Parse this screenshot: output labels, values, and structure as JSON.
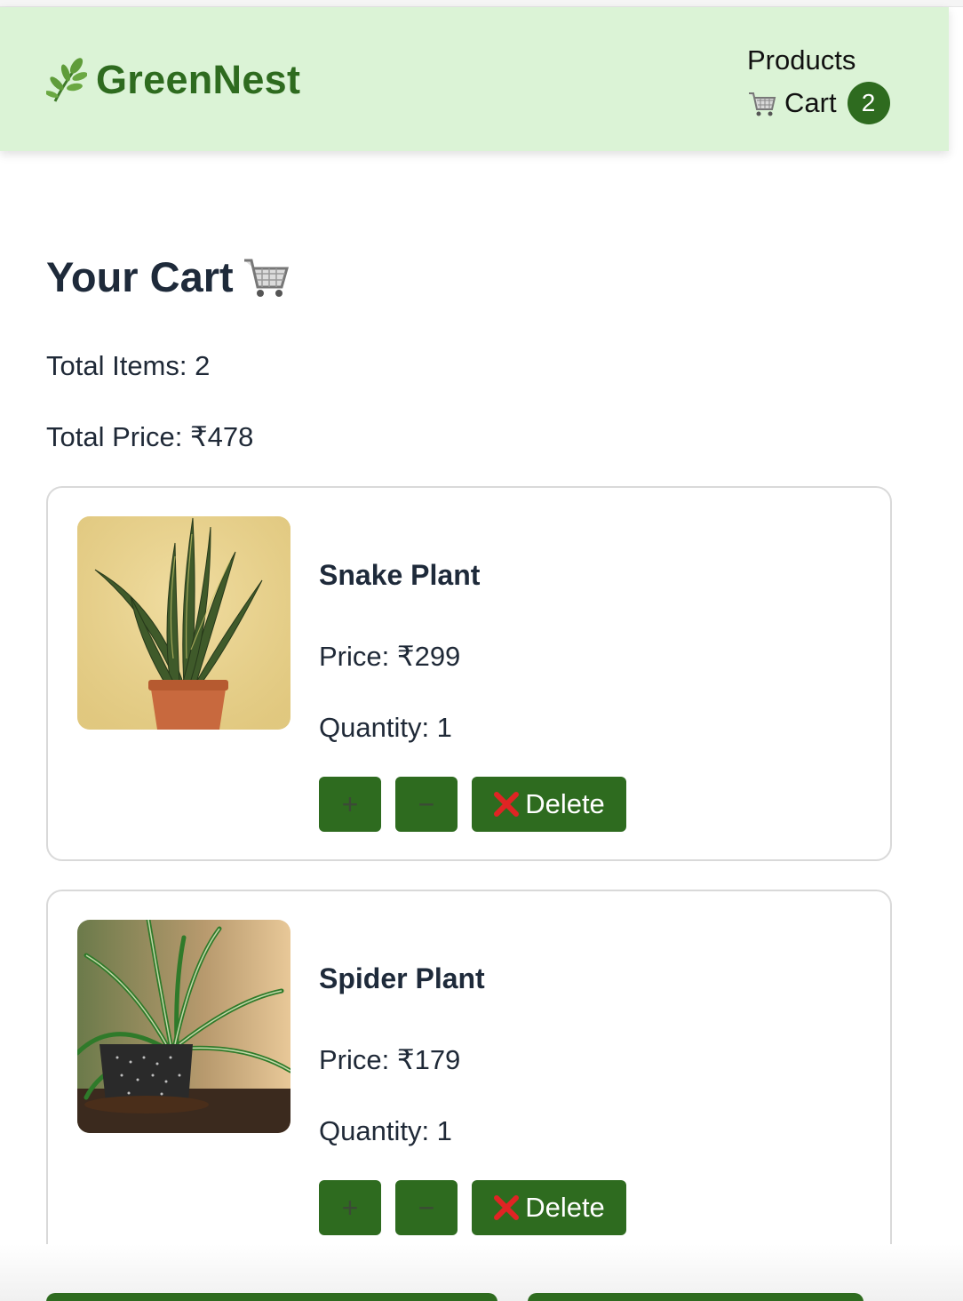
{
  "brand": {
    "name": "GreenNest",
    "icon": "herb-leaf-icon",
    "color": "#2e6b1f"
  },
  "nav": {
    "products_label": "Products",
    "cart_label": "Cart",
    "cart_count": "2",
    "background": "#dbf3d6"
  },
  "page": {
    "title": "Your Cart",
    "total_items": "Total Items: 2",
    "total_price": "Total Price: ₹478"
  },
  "items": [
    {
      "name": "Snake Plant",
      "price": "Price: ₹299",
      "quantity": "Quantity: 1",
      "image": "snake-plant-image",
      "increase_label": "+",
      "decrease_label": "−",
      "delete_label": "Delete"
    },
    {
      "name": "Spider Plant",
      "price": "Price: ₹179",
      "quantity": "Quantity: 1",
      "image": "spider-plant-image",
      "increase_label": "+",
      "decrease_label": "−",
      "delete_label": "Delete"
    }
  ],
  "colors": {
    "button": "#2e6b1f",
    "delete_icon": "#e02424"
  }
}
